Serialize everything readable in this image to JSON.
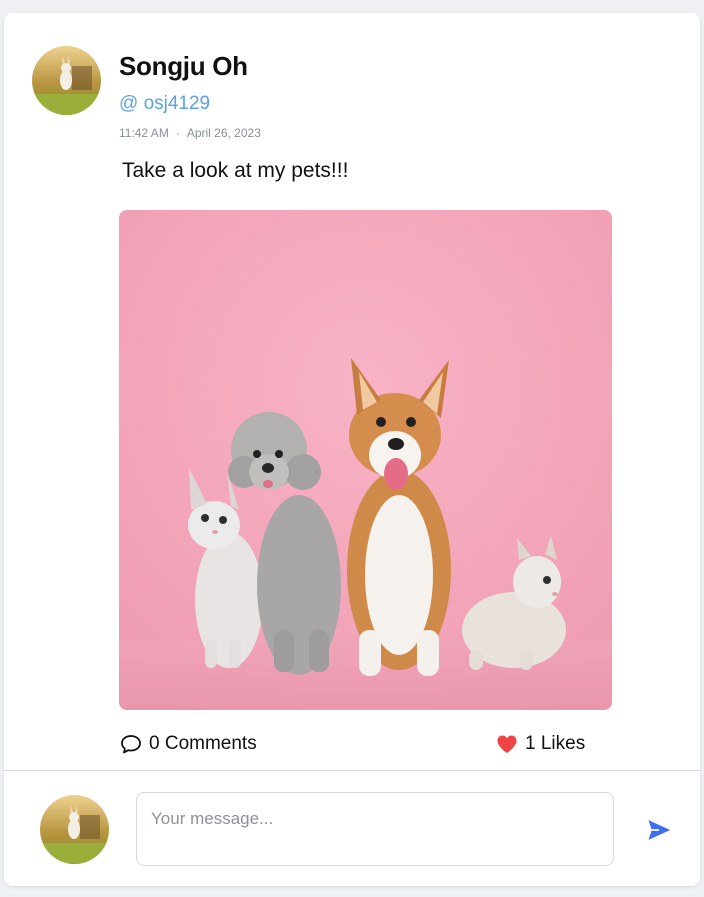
{
  "post": {
    "author_name": "Songju Oh",
    "author_handle": "@ osj4129",
    "time": "11:42 AM",
    "date": "April 26, 2023",
    "meta_separator": "·",
    "text": "Take a look at my pets!!!",
    "image_icon": "pets-photo"
  },
  "actions": {
    "comments_icon": "comment-bubble-icon",
    "comments_label": "0 Comments",
    "likes_icon": "heart-icon",
    "likes_label": "1 Likes"
  },
  "composer": {
    "placeholder": "Your message...",
    "send_icon": "send-icon"
  },
  "colors": {
    "handle": "#5aa2ea",
    "heart": "#ef4444",
    "send": "#3b6ef0",
    "photo_background": "#f2a4b9"
  }
}
